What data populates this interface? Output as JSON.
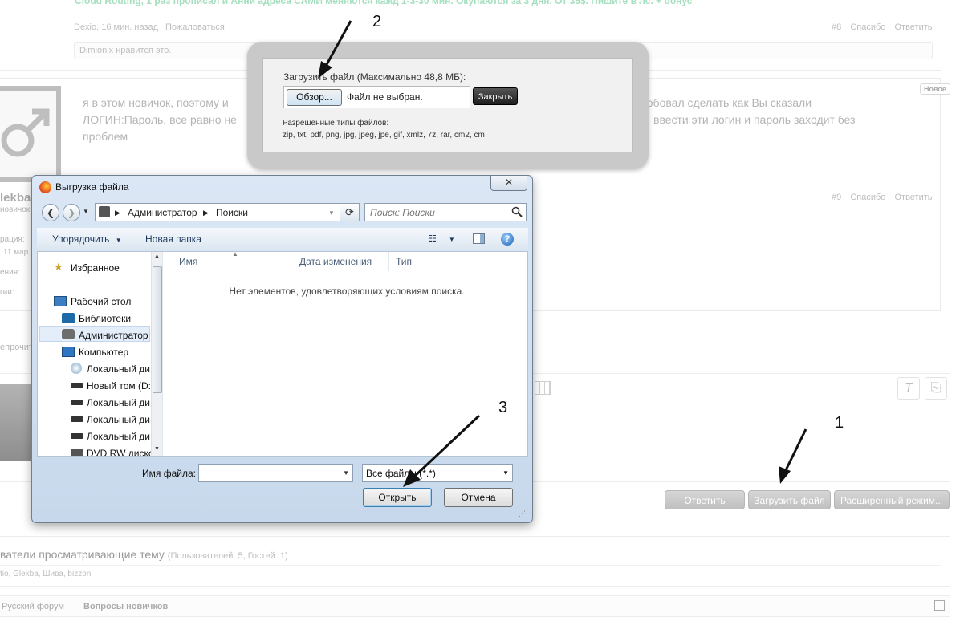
{
  "forum": {
    "post8": {
      "text_top": "Cloud Routing, 1 раз прописал и Анни адреса САМИ меняются кажд 1-3-30 мин. Окупаются за 3 дня. От 35$. Пишите в лс. + бонус",
      "author_time": "Dexio, 16 мин. назад",
      "report": "Пожаловаться",
      "number": "#8",
      "thanks": "Спасибо",
      "reply": "Ответить",
      "likes": "Dimionix нравится это."
    },
    "post9": {
      "new_badge": "Новое",
      "text_left_l1": "я в этом новичок, поэтому и",
      "text_left_l2": "ЛОГИН:Пароль, все равно не",
      "text_left_l3": "проблем",
      "text_right_l1": "робовал сделать как Вы сказали",
      "text_right_l2": "ввести эти логин и пароль заходит без",
      "author_name": "lekba",
      "author_rank": "новичок",
      "side_label_1": "рация:",
      "side_label_2": "11 мар",
      "side_label_3": "ения:",
      "side_label_4": "гии:",
      "number": "#9",
      "thanks": "Спасибо",
      "reply": "Ответить"
    },
    "unread_label": "епрочит",
    "buttons": {
      "reply": "Ответить",
      "upload": "Загрузить файл",
      "advanced": "Расширенный режим..."
    },
    "viewers": {
      "title": "ватели просматривающие тему",
      "count": "(Пользователей: 5, Гостей: 1)",
      "names": "tio, Glekba, Шива, bizzon"
    },
    "breadcrumb": [
      "Русский форум",
      "Вопросы новичков"
    ]
  },
  "upload_overlay": {
    "title": "Загрузить файл (Максимально 48,8 МБ):",
    "browse_label": "Обзор...",
    "no_file": "Файл не выбран.",
    "close_label": "Закрыть",
    "allowed_label": "Разрешённые типы файлов:",
    "allowed_types": "zip, txt, pdf, png, jpg, jpeg, jpe, gif, xmlz, 7z, rar, cm2, cm"
  },
  "dialog": {
    "title": "Выгрузка файла",
    "close": "✕",
    "path": [
      "Администратор",
      "Поиски"
    ],
    "search_placeholder": "Поиск: Поиски",
    "toolbar": {
      "organize": "Упорядочить",
      "new_folder": "Новая папка"
    },
    "nav": {
      "favorites": "Избранное",
      "desktop": "Рабочий стол",
      "libraries": "Библиотеки",
      "admin": "Администратор",
      "computer": "Компьютер",
      "drives": [
        "Локальный ди",
        "Новый том (D:",
        "Локальный ди",
        "Локальный ди",
        "Локальный ди",
        "DVD RW диско"
      ]
    },
    "columns": {
      "name": "Имя",
      "date": "Дата изменения",
      "type": "Тип"
    },
    "empty_message": "Нет элементов, удовлетворяющих условиям поиска.",
    "filename_label": "Имя файла:",
    "filetype_value": "Все файлы (*.*)",
    "open": "Открыть",
    "cancel": "Отмена"
  },
  "annotations": {
    "n1": "1",
    "n2": "2",
    "n3": "3"
  }
}
